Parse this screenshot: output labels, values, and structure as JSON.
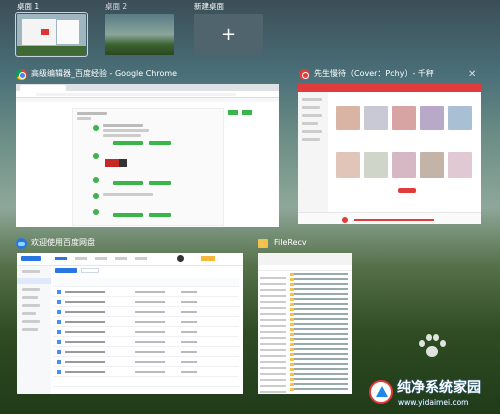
{
  "desktops": [
    {
      "label": "桌面 1",
      "selected": true
    },
    {
      "label": "桌面 2",
      "selected": false
    },
    {
      "label": "新建桌面",
      "selected": false,
      "icon": "plus-icon"
    }
  ],
  "windows": {
    "chrome": {
      "title": "高级编辑器_百度经验 - Google Chrome",
      "icon": "chrome-icon"
    },
    "music": {
      "title": "先生慢待（Cover：Pchy）- 千秤",
      "icon": "music-app-icon"
    },
    "baidu": {
      "title": "欢迎使用百度网盘",
      "icon": "baidu-netdisk-icon"
    },
    "explorer": {
      "title": "FileRecv",
      "icon": "folder-icon"
    }
  },
  "watermark": {
    "brand": "纯净系统家园",
    "url": "www.yidaimei.com"
  },
  "colors": {
    "accent_green": "#3ab54a",
    "music_red": "#e23b3b",
    "baidu_blue": "#2a76e0"
  }
}
